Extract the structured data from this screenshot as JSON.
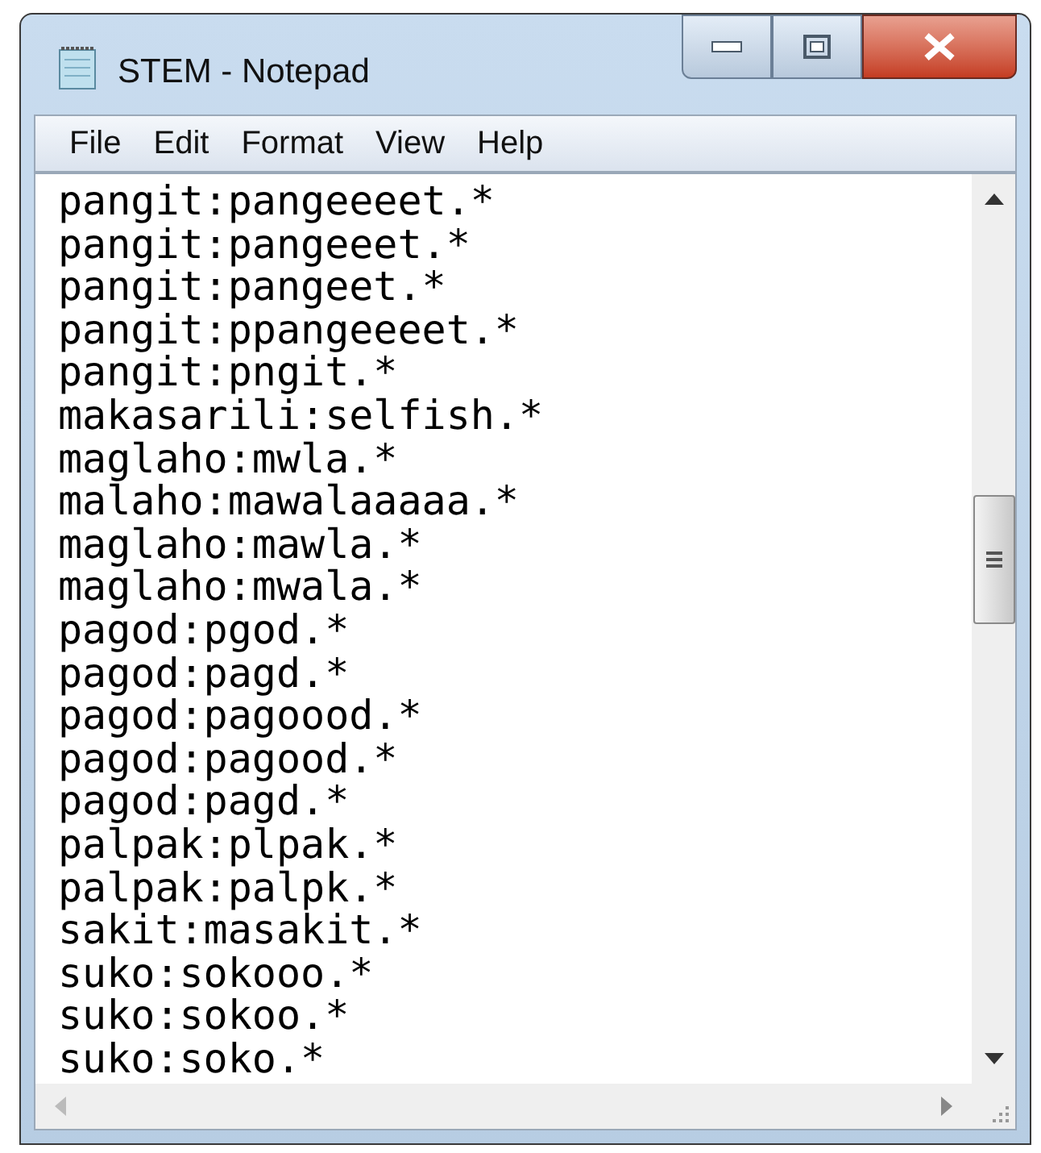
{
  "window": {
    "title": "STEM - Notepad"
  },
  "menu": [
    "File",
    "Edit",
    "Format",
    "View",
    "Help"
  ],
  "lines": [
    "pangit:pangeeeet.*",
    "pangit:pangeeet.*",
    "pangit:pangeet.*",
    "pangit:ppangeeeet.*",
    "pangit:pngit.*",
    "makasarili:selfish.*",
    "maglaho:mwla.*",
    "malaho:mawalaaaaa.*",
    "maglaho:mawla.*",
    "maglaho:mwala.*",
    "pagod:pgod.*",
    "pagod:pagd.*",
    "pagod:pagoood.*",
    "pagod:pagood.*",
    "pagod:pagd.*",
    "palpak:plpak.*",
    "palpak:palpk.*",
    "sakit:masakit.*",
    "suko:sokooo.*",
    "suko:sokoo.*",
    "suko:soko.*"
  ]
}
